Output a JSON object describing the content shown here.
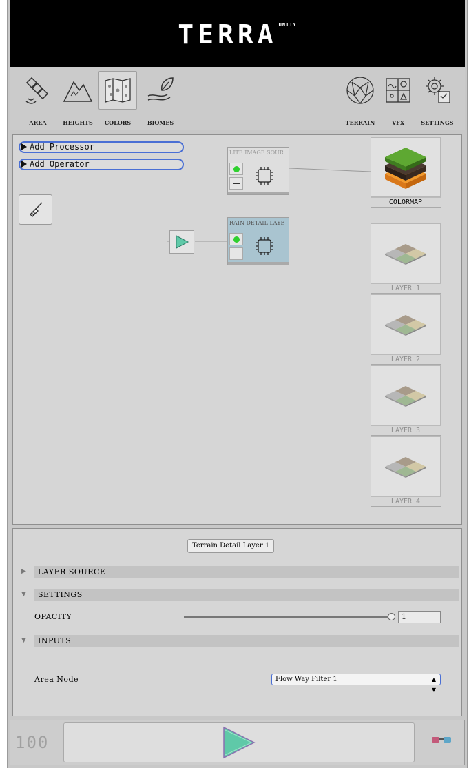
{
  "app": {
    "logo_text": "TERRA",
    "logo_sub": "UNITY"
  },
  "toolbar": {
    "left_tools": [
      {
        "name": "area",
        "label": "AREA",
        "icon": "satellite-icon"
      },
      {
        "name": "heights",
        "label": "HEIGHTS",
        "icon": "mountain-icon"
      },
      {
        "name": "colors",
        "label": "COLORS",
        "icon": "map-icon",
        "active": true
      },
      {
        "name": "biomes",
        "label": "BIOMES",
        "icon": "leaf-hand-icon"
      }
    ],
    "right_tools": [
      {
        "name": "terrain",
        "label": "TERRAIN",
        "icon": "globe-icon"
      },
      {
        "name": "vfx",
        "label": "VFX",
        "icon": "vfx-icon"
      },
      {
        "name": "settings",
        "label": "SETTINGS",
        "icon": "gear-icon"
      }
    ]
  },
  "graph": {
    "add_processor": "Add Processor",
    "add_operator": "Add Operator",
    "nodes": [
      {
        "title": "LITE IMAGE SOUR"
      },
      {
        "title": "RAIN DETAIL LAYE"
      }
    ],
    "outputs": [
      {
        "label": "COLORMAP"
      },
      {
        "label": "LAYER 1"
      },
      {
        "label": "LAYER 2"
      },
      {
        "label": "LAYER 3"
      },
      {
        "label": "LAYER 4"
      }
    ]
  },
  "inspector": {
    "title": "Terrain Detail Layer 1",
    "sections": {
      "layer_source": "LAYER SOURCE",
      "settings": "SETTINGS",
      "inputs": "INPUTS"
    },
    "opacity_label": "OPACITY",
    "opacity_value": "1",
    "opacity_level": 1.0,
    "area_node_label": "Area Node",
    "area_node_value": "Flow Way Filter 1"
  },
  "bottom": {
    "counter": "100"
  },
  "colors": {
    "accent_blue": "#4a6fd4",
    "active_green": "#2fd02f",
    "selected_node": "#a9c4d0",
    "play_teal": "#5fc9a8"
  }
}
